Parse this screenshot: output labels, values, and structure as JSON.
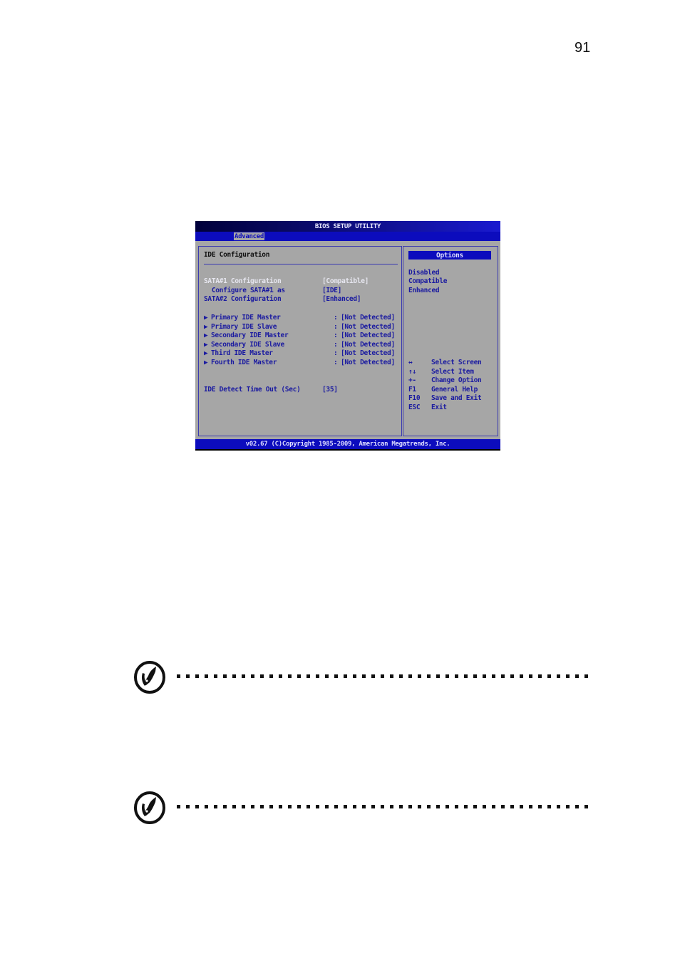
{
  "page": {
    "number": "91"
  },
  "bios": {
    "title": "BIOS SETUP UTILITY",
    "active_tab": "Advanced",
    "section_title": "IDE Configuration",
    "settings": [
      {
        "label": "SATA#1 Configuration",
        "value": "[Compatible]",
        "selected": true
      },
      {
        "label": "  Configure SATA#1 as",
        "value": "[IDE]",
        "selected": false
      },
      {
        "label": "SATA#2 Configuration",
        "value": "[Enhanced]",
        "selected": false
      }
    ],
    "devices": [
      {
        "label": "Primary IDE Master",
        "value": "[Not Detected]"
      },
      {
        "label": "Primary IDE Slave",
        "value": "[Not Detected]"
      },
      {
        "label": "Secondary IDE Master",
        "value": "[Not Detected]"
      },
      {
        "label": "Secondary IDE Slave",
        "value": "[Not Detected]"
      },
      {
        "label": "Third IDE Master",
        "value": "[Not Detected]"
      },
      {
        "label": "Fourth IDE Master",
        "value": "[Not Detected]"
      }
    ],
    "device_arrow": "▶",
    "device_separator": ":",
    "timeout": {
      "label": "IDE Detect Time Out (Sec)",
      "value": "[35]"
    },
    "options_header": "Options",
    "options": [
      "Disabled",
      "Compatible",
      "Enhanced"
    ],
    "help": [
      {
        "key": "↔",
        "action": "Select Screen"
      },
      {
        "key": "↑↓",
        "action": "Select Item"
      },
      {
        "key": "+-",
        "action": "Change Option"
      },
      {
        "key": "F1",
        "action": "General Help"
      },
      {
        "key": "F10",
        "action": "Save and Exit"
      },
      {
        "key": "ESC",
        "action": "Exit"
      }
    ],
    "footer": "v02.67 (C)Copyright 1985-2009, American Megatrends, Inc."
  },
  "notes": [
    {
      "icon": "note-pen-icon"
    },
    {
      "icon": "note-pen-icon"
    }
  ]
}
